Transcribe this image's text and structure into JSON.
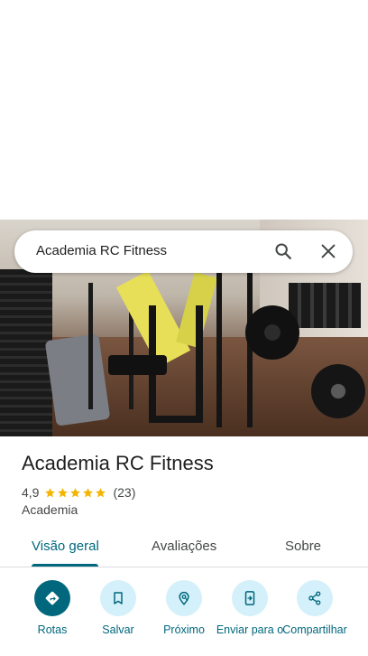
{
  "search": {
    "query": "Academia RC Fitness"
  },
  "place": {
    "name": "Academia RC Fitness",
    "rating": "4,9",
    "review_count": "(23)",
    "stars": 5,
    "category": "Academia"
  },
  "tabs": [
    {
      "label": "Visão geral",
      "active": true
    },
    {
      "label": "Avaliações",
      "active": false
    },
    {
      "label": "Sobre",
      "active": false
    }
  ],
  "actions": [
    {
      "label": "Rotas",
      "icon": "directions-icon"
    },
    {
      "label": "Salvar",
      "icon": "bookmark-icon"
    },
    {
      "label": "Próximo",
      "icon": "nearby-icon"
    },
    {
      "label": "Enviar para o",
      "icon": "send-to-phone-icon"
    },
    {
      "label": "Compartilhar",
      "icon": "share-icon"
    }
  ],
  "colors": {
    "accent": "#00677d",
    "action_bg": "#d4f0fa",
    "star": "#f4b400"
  }
}
